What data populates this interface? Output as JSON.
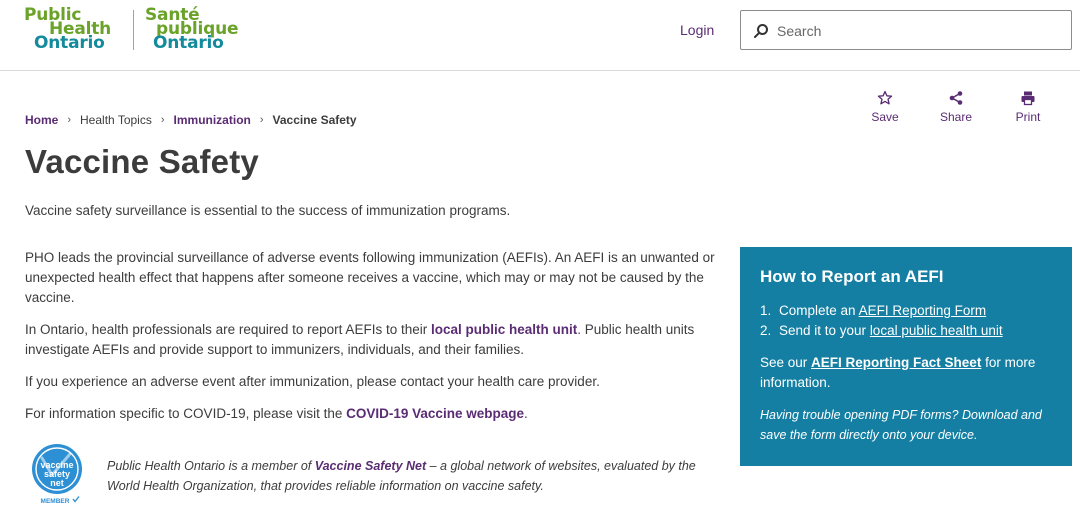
{
  "header": {
    "logo_en": [
      "Public",
      "Health",
      "Ontario"
    ],
    "logo_fr": [
      "Santé",
      "publique",
      "Ontario"
    ],
    "login_label": "Login",
    "search_placeholder": "Search"
  },
  "breadcrumb": [
    "Home",
    "Health Topics",
    "Immunization",
    "Vaccine Safety"
  ],
  "actions": {
    "save": "Save",
    "share": "Share",
    "print": "Print"
  },
  "page": {
    "title": "Vaccine Safety",
    "intro": "Vaccine safety surveillance is essential to the success of immunization programs.",
    "p1": "PHO leads the provincial surveillance of adverse events following immunization (AEFIs). An AEFI is an unwanted or unexpected health effect that happens after someone receives a vaccine, which may or may not be caused by the vaccine.",
    "p2_before": "In Ontario, health professionals are required to report AEFIs to their ",
    "p2_link": "local public health unit",
    "p2_after": ". Public health units investigate AEFIs and provide support to immunizers, individuals, and their families.",
    "p3": "If you experience an adverse event after immunization, please contact your health care provider.",
    "p4_before": "For information specific to COVID-19, please visit the ",
    "p4_link": "COVID-19 Vaccine webpage",
    "p4_after": "."
  },
  "membership": {
    "badge_lines": [
      "vaccine",
      "safety",
      "net"
    ],
    "badge_member": "MEMBER",
    "text_before": "Public Health Ontario is a member of ",
    "text_link": "Vaccine Safety Net",
    "text_after": " – a global network of websites, evaluated by the World Health Organization, that provides reliable information on vaccine safety."
  },
  "aefi": {
    "title": "How to Report an AEFI",
    "step1_num": "1.",
    "step1_before": "Complete an ",
    "step1_link": "AEFI Reporting Form",
    "step2_num": "2.",
    "step2_before": "Send it to your ",
    "step2_link": "local public health unit",
    "see_before": "See our ",
    "see_link": "AEFI Reporting Fact Sheet",
    "see_after": " for more information.",
    "note": "Having trouble opening PDF forms? Download and save the form directly onto your device."
  },
  "colors": {
    "brand_purple": "#5a2c74",
    "logo_green": "#6aa22a",
    "logo_teal": "#148b9c",
    "aefi_box": "#147fa2",
    "badge_blue": "#2d8fd4"
  },
  "icons": [
    "search-icon",
    "star-icon",
    "share-icon",
    "print-icon",
    "chevron-right-icon",
    "vaccine-safety-net-badge"
  ]
}
